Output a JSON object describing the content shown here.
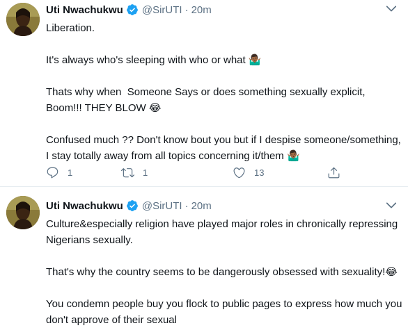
{
  "tweets": [
    {
      "author": "Uti Nwachukwu",
      "handle": "@SirUTI",
      "separator": "·",
      "time": "20m",
      "paragraphs": [
        "Liberation.",
        "It's always who's sleeping with who or what 🤷🏾‍♂️",
        "Thats why when  Someone Says or does something sexually explicit, Boom!!! THEY BLOW 😂",
        "Confused much ?? Don't know bout you but if I despise someone/something, I stay totally away from all topics concerning it/them 🤷🏾‍♂️"
      ],
      "replies": "1",
      "retweets": "1",
      "likes": "13"
    },
    {
      "author": "Uti Nwachukwu",
      "handle": "@SirUTI",
      "separator": "·",
      "time": "20m",
      "paragraphs": [
        "Culture&especially religion have played major roles in chronically repressing Nigerians sexually.",
        "That's why the country seems to be dangerously obsessed with sexuality!😂",
        "You condemn people buy you flock to public pages to express how much you don't approve of their sexual"
      ]
    }
  ],
  "icons": {
    "verified": "verified-badge-icon",
    "caret": "chevron-down-icon",
    "reply": "reply-icon",
    "retweet": "retweet-icon",
    "like": "heart-icon",
    "share": "share-icon"
  },
  "colors": {
    "accent": "#1da1f2",
    "muted": "#5b7083",
    "text": "#0f1419",
    "divider": "#e6ecf0"
  }
}
